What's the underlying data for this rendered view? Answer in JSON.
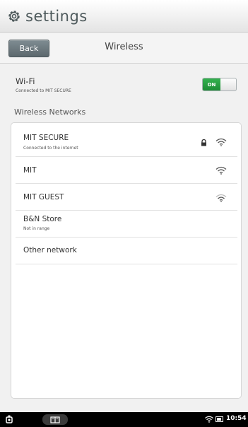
{
  "header": {
    "title": "settings",
    "icon": "gear-icon"
  },
  "nav": {
    "back_label": "Back",
    "title": "Wireless"
  },
  "wifi": {
    "label": "Wi-Fi",
    "status": "Connected to MIT SECURE",
    "toggle_label": "ON",
    "toggle_on": true,
    "accent": "#2a9e43"
  },
  "networks_title": "Wireless Networks",
  "networks": [
    {
      "name": "MIT SECURE",
      "status": "Connected to the internet",
      "locked": true,
      "signal": true
    },
    {
      "name": "MIT",
      "status": "",
      "locked": false,
      "signal": true
    },
    {
      "name": "MIT GUEST",
      "status": "",
      "locked": false,
      "signal": true
    },
    {
      "name": "B&N Store",
      "status": "Not in range",
      "locked": false,
      "signal": false
    },
    {
      "name": "Other network",
      "status": "",
      "locked": false,
      "signal": false
    }
  ],
  "statusbar": {
    "time": "10:54"
  }
}
